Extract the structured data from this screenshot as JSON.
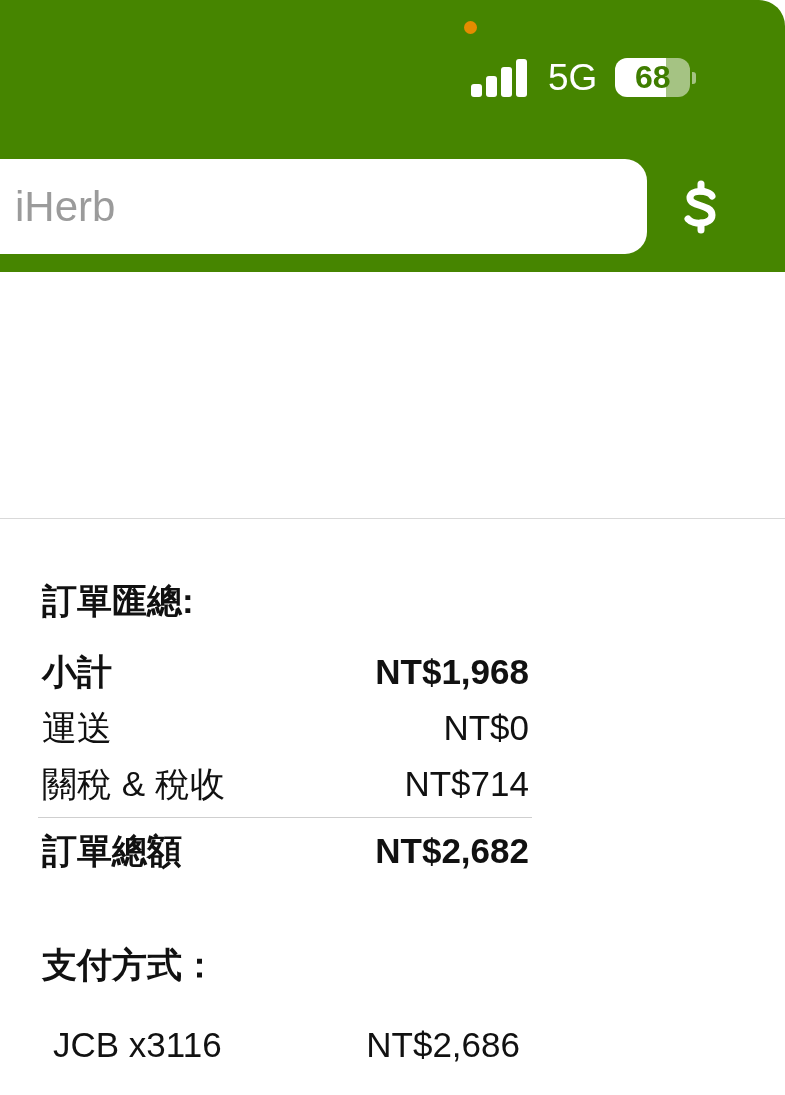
{
  "status_bar": {
    "network": "5G",
    "battery": "68"
  },
  "search": {
    "placeholder": "iHerb"
  },
  "order_summary": {
    "title": "訂單匯總:",
    "rows": [
      {
        "kind": "subtotal",
        "label": "小計",
        "value": "NT$1,968"
      },
      {
        "kind": "item",
        "label": "運送",
        "value": "NT$0"
      },
      {
        "kind": "item",
        "label": "關稅 & 稅收",
        "value": "NT$714"
      },
      {
        "kind": "total",
        "label": "訂單總額",
        "value": "NT$2,682"
      }
    ]
  },
  "payment": {
    "title": "支付方式：",
    "methods": [
      {
        "label": "JCB x3116",
        "amount": "NT$2,686"
      }
    ]
  }
}
